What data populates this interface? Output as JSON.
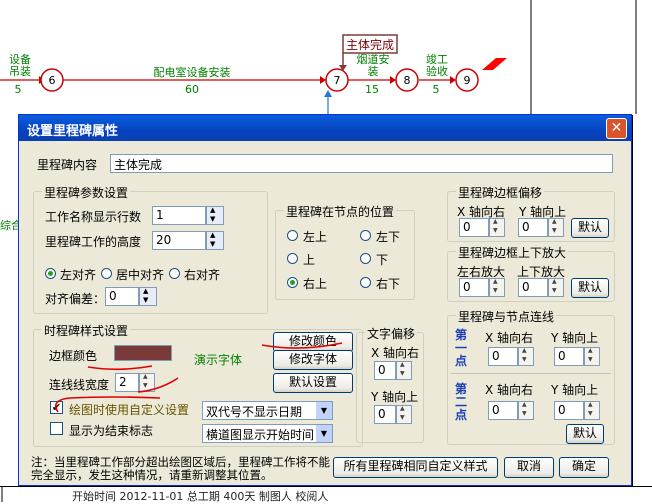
{
  "chart_data": {
    "type": "network",
    "nodes": [
      {
        "id": "6",
        "label": "6"
      },
      {
        "id": "7",
        "label": "7"
      },
      {
        "id": "8",
        "label": "8"
      },
      {
        "id": "9",
        "label": "9"
      }
    ],
    "edges": [
      {
        "from": "?",
        "to": "6",
        "label_lines": [
          "设备",
          "吊装"
        ],
        "duration": "5"
      },
      {
        "from": "6",
        "to": "7",
        "label_lines": [
          "配电室设备安装"
        ],
        "duration": "60"
      },
      {
        "from": "7",
        "to": "8",
        "label_lines": [
          "烟道安",
          "装"
        ],
        "duration": "15"
      },
      {
        "from": "8",
        "to": "9",
        "label_lines": [
          "竣工",
          "验收"
        ],
        "duration": "5"
      }
    ],
    "milestone": {
      "label": "主体完成",
      "node": "7"
    },
    "left_fragment": "综合"
  },
  "colors": {
    "milestone_border": "#7b3a3a",
    "edge": "#cc0000",
    "label": "#008000",
    "flag": "#ff0000"
  },
  "dialog": {
    "title": "设置里程碑属性",
    "close_icon": "close-icon",
    "content_label": "里程碑内容",
    "content_value": "主体完成",
    "params": {
      "title": "里程碑参数设置",
      "rows_label": "工作名称显示行数",
      "rows_value": "1",
      "height_label": "里程碑工作的高度",
      "height_value": "20",
      "align_left": "左对齐",
      "align_center": "居中对齐",
      "align_right": "右对齐",
      "offset_label": "对齐偏差：",
      "offset_value": "0"
    },
    "position": {
      "title": "里程碑在节点的位置",
      "opts": [
        "左上",
        "左下",
        "上",
        "下",
        "右上",
        "右下"
      ],
      "selected": "右上"
    },
    "border_offset": {
      "title": "里程碑边框偏移",
      "x_label": "X 轴向右",
      "y_label": "Y 轴向上",
      "x_value": "0",
      "y_value": "0",
      "default_btn": "默认"
    },
    "border_scale": {
      "title": "里程碑边框上下放大",
      "x_label": "左右放大",
      "y_label": "上下放大",
      "x_value": "0",
      "y_value": "0",
      "default_btn": "默认"
    },
    "style": {
      "title": "时程碑样式设置",
      "border_color_label": "边框颜色",
      "demo_font": "演示字体",
      "modify_color_btn": "修改颜色",
      "modify_font_btn": "修改字体",
      "default_btn": "默认设置",
      "line_width_label": "连线线宽度",
      "line_width_value": "2",
      "custom_label": "绘图时使用自定义设置",
      "custom_checked": true,
      "end_label": "显示为结束标志",
      "end_checked": false,
      "date_select": "双代号不显示日期",
      "time_select": "横道图显示开始时间"
    },
    "text_offset": {
      "title": "文字偏移",
      "x_label": "X 轴向右",
      "y_label": "Y 轴向上",
      "x_value": "0",
      "y_value": "0"
    },
    "node_link": {
      "title": "里程碑与节点连线",
      "first_point": "第一点",
      "second_point": "第二点",
      "x_label": "X 轴向右",
      "y_label": "Y 轴向上",
      "p1_x": "0",
      "p1_y": "0",
      "p2_x": "0",
      "p2_y": "0",
      "default_btn": "默认"
    },
    "note": "注：当里程碑工作部分超出绘图区域后，里程碑工作将不能完全显示，发生这种情况，请重新调整其位置。",
    "same_style_btn": "所有里程碑相同自定义样式",
    "cancel_btn": "取消",
    "ok_btn": "确定"
  },
  "bottom_fragment": "开始时间   2012-11-01   总工期   400天   制图人               校阅人"
}
